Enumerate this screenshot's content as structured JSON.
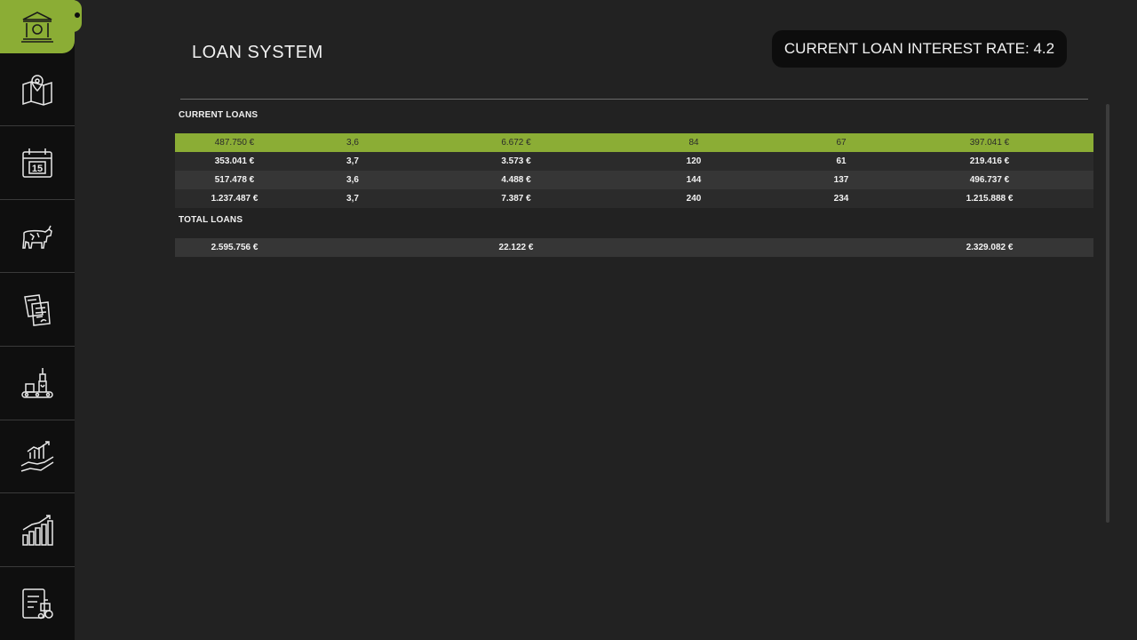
{
  "header": {
    "title": "LOAN SYSTEM",
    "interest_rate_text": "CURRENT LOAN INTEREST RATE: 4.2"
  },
  "sidebar": {
    "items": [
      {
        "icon": "bank-icon",
        "active": true
      },
      {
        "icon": "map-icon",
        "active": false
      },
      {
        "icon": "calendar-icon",
        "active": false,
        "day": "15"
      },
      {
        "icon": "cow-icon",
        "active": false
      },
      {
        "icon": "contracts-icon",
        "active": false
      },
      {
        "icon": "production-icon",
        "active": false
      },
      {
        "icon": "growth-hand-icon",
        "active": false
      },
      {
        "icon": "statistics-icon",
        "active": false
      },
      {
        "icon": "vehicle-report-icon",
        "active": false
      }
    ]
  },
  "current_loans": {
    "label": "CURRENT LOANS",
    "rows": [
      [
        "487.750 €",
        "3,6",
        "6.672 €",
        "84",
        "67",
        "397.041 €"
      ],
      [
        "353.041 €",
        "3,7",
        "3.573 €",
        "120",
        "61",
        "219.416 €"
      ],
      [
        "517.478 €",
        "3,6",
        "4.488 €",
        "144",
        "137",
        "496.737 €"
      ],
      [
        "1.237.487 €",
        "3,7",
        "7.387 €",
        "240",
        "234",
        "1.215.888 €"
      ]
    ]
  },
  "total_loans": {
    "label": "TOTAL LOANS",
    "row": [
      "2.595.756 €",
      "",
      "22.122 €",
      "",
      "",
      "2.329.082 €"
    ]
  },
  "colors": {
    "accent": "#8bad35",
    "background": "#222222",
    "sidebar": "#0f0f0f"
  }
}
